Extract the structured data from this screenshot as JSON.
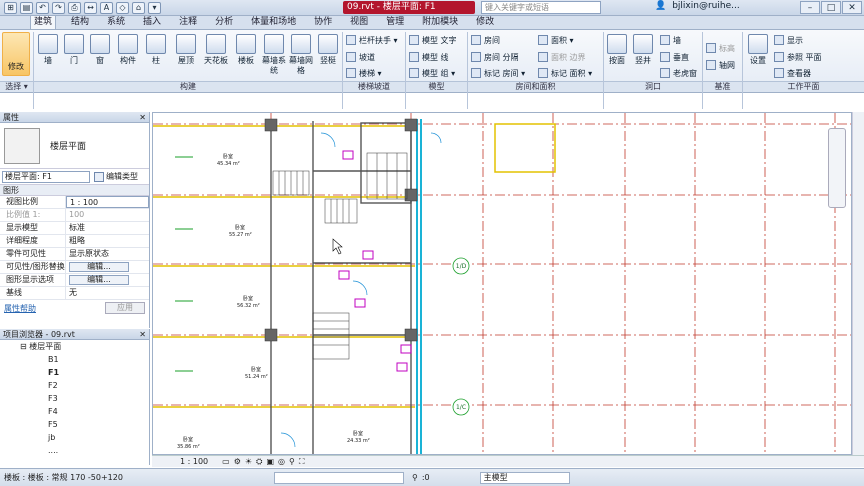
{
  "titlebar": {
    "doc_title": "09.rvt - 楼层平面: F1",
    "search_placeholder": "键入关键字或短语",
    "user": "bjlixin@ruihe...",
    "win_min": "–",
    "win_max": "□",
    "win_close": "✕",
    "qat": [
      "⊞",
      "▤",
      "↶",
      "↷",
      "⎙",
      "↔",
      "A",
      "◇",
      "⌂",
      "▾"
    ]
  },
  "tabs": [
    "建筑",
    "结构",
    "系统",
    "插入",
    "注释",
    "分析",
    "体量和场地",
    "协作",
    "视图",
    "管理",
    "附加模块",
    "修改"
  ],
  "ribbon": {
    "modify": "修改",
    "select": "选择 ▾",
    "build_buttons": [
      "墙",
      "门",
      "窗",
      "构件",
      "柱",
      "屋顶",
      "天花板",
      "楼板",
      "幕墙系统",
      "幕墙网格",
      "竖梃"
    ],
    "build_panel": "构建",
    "stair_items": [
      "栏杆扶手 ▾",
      "坡道",
      "楼梯 ▾"
    ],
    "stair_panel": "楼梯坡道",
    "model_items": [
      "模型 文字",
      "模型 线",
      "模型 组 ▾"
    ],
    "model_panel": "模型",
    "room_items": [
      "房间",
      "房间 分隔",
      "标记 房间 ▾",
      "面积 ▾",
      "面积 边界",
      "标记 面积 ▾"
    ],
    "room_panel": "房间和面积",
    "opening_items": [
      "按面",
      "竖井",
      "墙",
      "垂直",
      "老虎窗"
    ],
    "opening_panel": "洞口",
    "datum_items": [
      "标高",
      "轴网"
    ],
    "datum_panel": "基准",
    "work_items": [
      "设置",
      "显示",
      "参照 平面",
      "查看器"
    ],
    "work_panel": "工作平面"
  },
  "properties": {
    "header": "属性",
    "close": "✕",
    "type_name": "楼层平面",
    "view_select": "楼层平面: F1",
    "edit_type": "编辑类型",
    "group": "图形",
    "rows": [
      {
        "k": "视图比例",
        "v": "1 : 100"
      },
      {
        "k": "比例值 1:",
        "v": "100"
      },
      {
        "k": "显示模型",
        "v": "标准"
      },
      {
        "k": "详细程度",
        "v": "粗略"
      },
      {
        "k": "零件可见性",
        "v": "显示原状态"
      },
      {
        "k": "可见性/图形替换",
        "v": "编辑..."
      },
      {
        "k": "图形显示选项",
        "v": "编辑..."
      },
      {
        "k": "基线",
        "v": "无"
      }
    ],
    "help": "属性帮助",
    "apply": "应用"
  },
  "browser": {
    "header": "项目浏览器 - 09.rvt",
    "root": "⊟ 楼层平面",
    "levels": [
      "B1",
      "F1",
      "F2",
      "F3",
      "F4",
      "F5",
      "jb",
      "...."
    ]
  },
  "canvas": {
    "room_label": "卧室",
    "areas": [
      "45.34 m²",
      "55.27 m²",
      "56.32 m²",
      "51.24 m²",
      "35.86 m²",
      "24.33 m²"
    ],
    "grid_tags": [
      "1/D",
      "1/C"
    ]
  },
  "viewbar": {
    "scale": "1 : 100"
  },
  "statusbar": {
    "left": "楼板 : 楼板 : 常规 170 -50+120",
    "zero": ":0",
    "model": "主模型"
  },
  "colors": {
    "grid": "#c0392b",
    "wall": "#444",
    "room_tag": "#c000c0",
    "accent": "#f7c565"
  }
}
